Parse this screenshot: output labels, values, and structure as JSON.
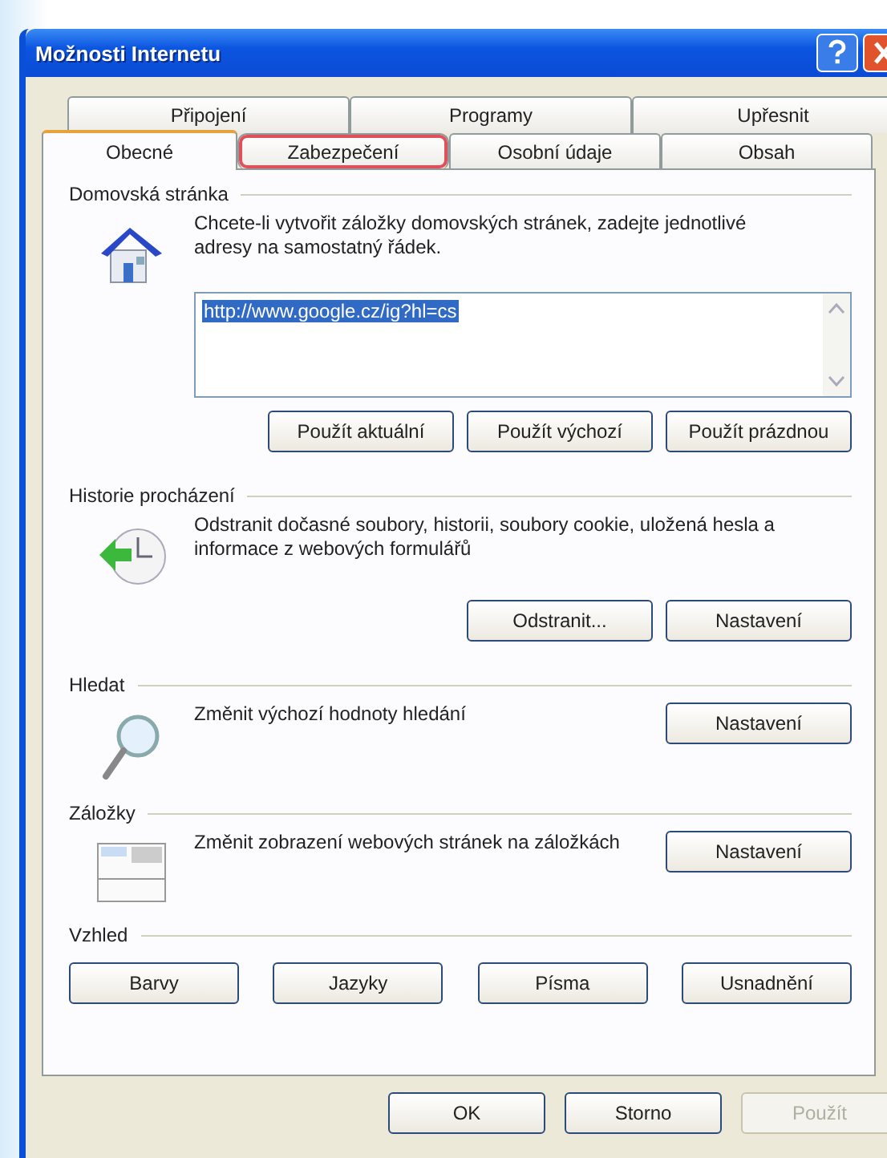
{
  "window": {
    "title": "Možnosti Internetu"
  },
  "tab_rows": [
    [
      {
        "label": "Připojení",
        "selected": false,
        "highlighted": false
      },
      {
        "label": "Programy",
        "selected": false,
        "highlighted": false
      },
      {
        "label": "Upřesnit",
        "selected": false,
        "highlighted": false
      }
    ],
    [
      {
        "label": "Obecné",
        "selected": true,
        "highlighted": false
      },
      {
        "label": "Zabezpečení",
        "selected": false,
        "highlighted": true
      },
      {
        "label": "Osobní údaje",
        "selected": false,
        "highlighted": false
      },
      {
        "label": "Obsah",
        "selected": false,
        "highlighted": false
      }
    ]
  ],
  "sections": [
    {
      "kind": "home",
      "title": "Domovská stránka",
      "description": "Chcete-li vytvořit záložky domovských stránek, zadejte jednotlivé adresy na samostatný řádek.",
      "field": {
        "value": "http://www.google.cz/ig?hl=cs",
        "value_selected": true
      },
      "buttons": [
        "Použít aktuální",
        "Použít výchozí",
        "Použít prázdnou"
      ]
    },
    {
      "kind": "history",
      "title": "Historie procházení",
      "description": "Odstranit dočasné soubory, historii, soubory cookie, uložená hesla a informace z webových formulářů",
      "buttons": [
        "Odstranit...",
        "Nastavení"
      ]
    },
    {
      "kind": "search",
      "title": "Hledat",
      "description": "Změnit výchozí hodnoty hledání",
      "buttons": [
        "Nastavení"
      ]
    },
    {
      "kind": "tabs",
      "title": "Záložky",
      "description": "Změnit zobrazení webových stránek na záložkách",
      "buttons": [
        "Nastavení"
      ]
    },
    {
      "kind": "appearance",
      "title": "Vzhled",
      "buttons": [
        "Barvy",
        "Jazyky",
        "Písma",
        "Usnadnění"
      ]
    }
  ],
  "dialog_buttons": [
    {
      "label": "OK",
      "disabled": false
    },
    {
      "label": "Storno",
      "disabled": false
    },
    {
      "label": "Použít",
      "disabled": true
    }
  ]
}
